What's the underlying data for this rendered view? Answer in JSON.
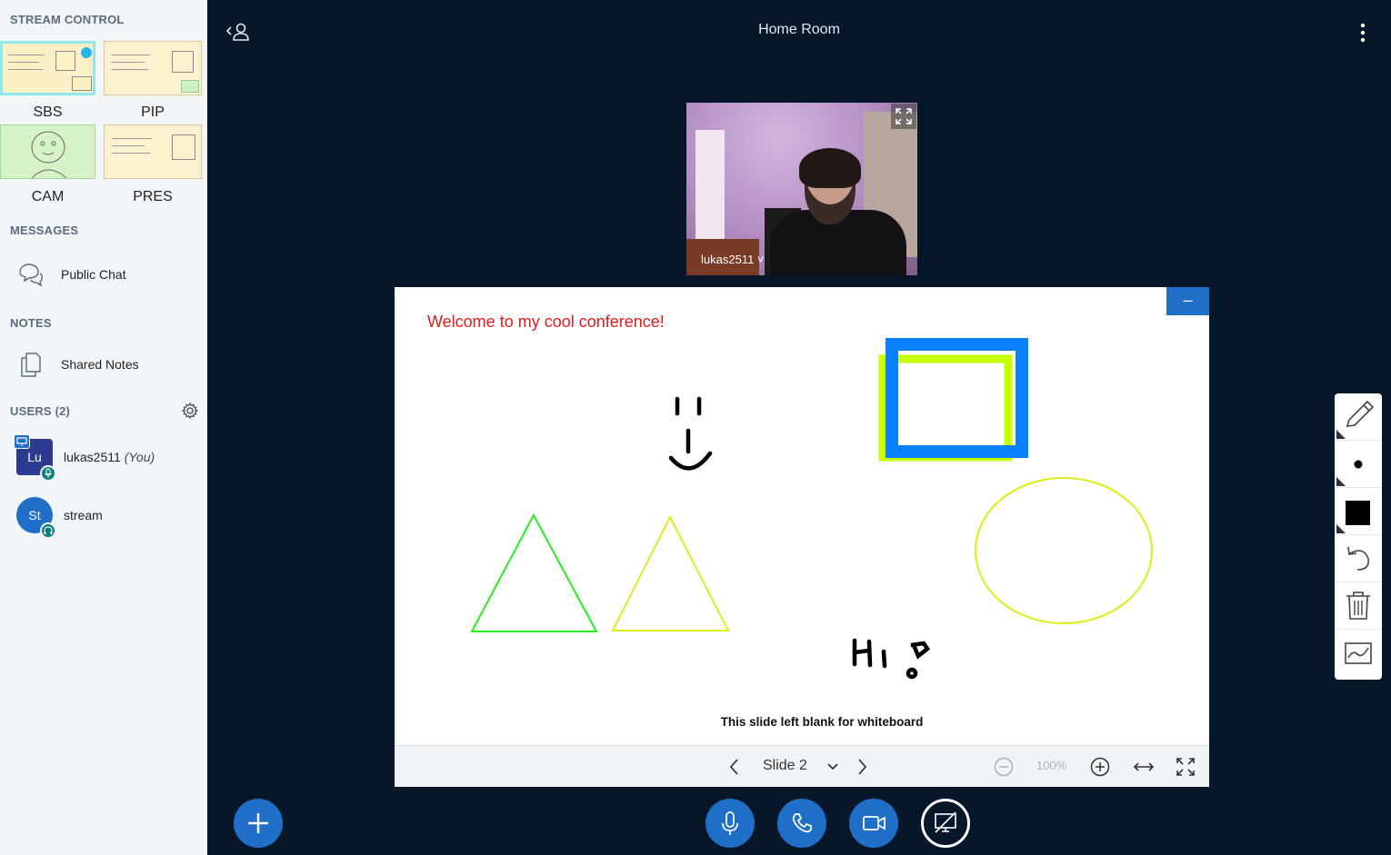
{
  "app": {
    "room_title": "Home Room"
  },
  "sidebar": {
    "stream_control": {
      "title": "STREAM CONTROL",
      "layouts": [
        {
          "label": "SBS",
          "active": true
        },
        {
          "label": "PIP",
          "active": false
        },
        {
          "label": "CAM",
          "active": false
        },
        {
          "label": "PRES",
          "active": false
        }
      ]
    },
    "messages": {
      "title": "MESSAGES",
      "public_chat": "Public Chat"
    },
    "notes": {
      "title": "NOTES",
      "shared_notes": "Shared Notes"
    },
    "users": {
      "title": "USERS (2)",
      "list": [
        {
          "initials": "Lu",
          "name": "lukas2511",
          "suffix": "(You)",
          "presenter": true,
          "audio": "mic"
        },
        {
          "initials": "St",
          "name": "stream",
          "suffix": "",
          "presenter": false,
          "audio": "listen"
        }
      ]
    }
  },
  "webcam": {
    "username": "lukas2511 ˅"
  },
  "whiteboard": {
    "welcome_text": "Welcome to my cool conference!",
    "hi_text": "HI!",
    "footer_text": "This slide left blank for whiteboard",
    "minimize_label": "–",
    "colors": {
      "welcome": "#e8191a",
      "blue_rect": "#0b80ff",
      "lime_rect": "#c6ff00",
      "green_triangle": "#27ef1e",
      "yellow": "#dced1e"
    }
  },
  "slide_controls": {
    "slide_label": "Slide 2",
    "zoom": "100%"
  },
  "tools": [
    "pencil-icon",
    "thickness-dot-icon",
    "color-square-icon",
    "undo-icon",
    "trash-icon",
    "multi-user-icon"
  ],
  "accent_color": "#1f6fc8"
}
